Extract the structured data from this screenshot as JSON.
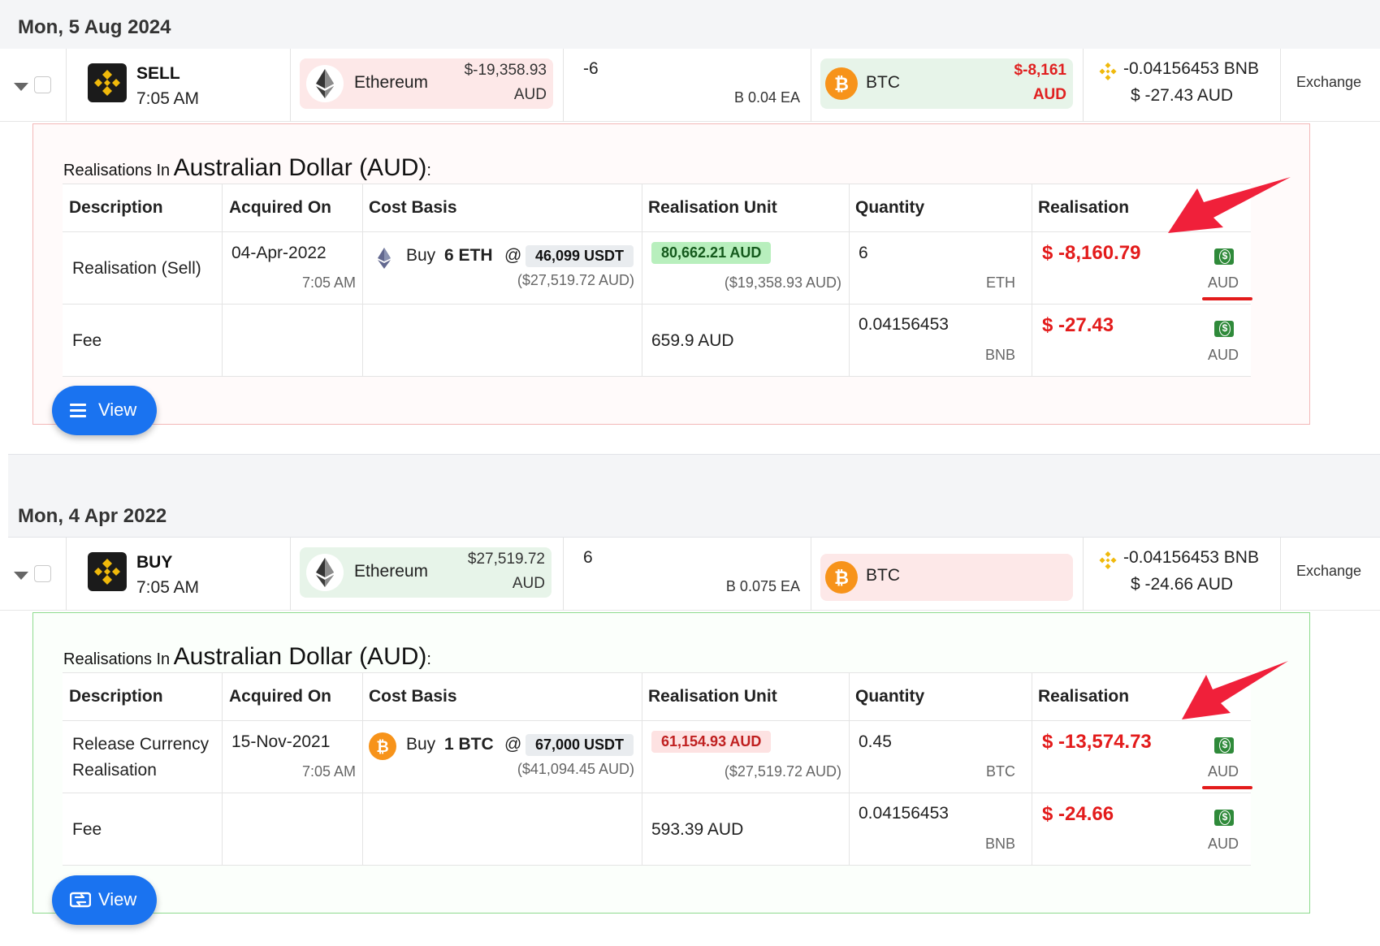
{
  "groups": [
    {
      "date": "Mon, 5 Aug 2024",
      "txn": {
        "side": "SELL",
        "time": "7:05 AM",
        "sent_asset": "Ethereum",
        "sent_value": "$-19,358.93",
        "sent_currency": "AUD",
        "qty": "-6",
        "rate": "B 0.04 EA",
        "recv_asset": "BTC",
        "recv_value": "$-8,161",
        "recv_currency": "AUD",
        "fee_amount": "-0.04156453 BNB",
        "fee_value": "$ -27.43 AUD",
        "type": "Exchange"
      },
      "realisation": {
        "prefix": "Realisations In",
        "currency_name": "Australian Dollar (AUD)",
        "suffix": ":",
        "headers": [
          "Description",
          "Acquired On",
          "Cost Basis",
          "Realisation Unit",
          "Quantity",
          "Realisation"
        ],
        "rows": [
          {
            "description": "Realisation (Sell)",
            "acquired_date": "04-Apr-2022",
            "acquired_time": "7:05 AM",
            "cost_buy": "Buy",
            "cost_qty": "6 ETH",
            "cost_at": "@",
            "cost_price": "46,099 USDT",
            "cost_aud": "($27,519.72 AUD)",
            "unit_value": "80,662.21 AUD",
            "unit_aud": "($19,358.93 AUD)",
            "quantity": "6",
            "quantity_unit": "ETH",
            "realisation": "$ -8,160.79",
            "realisation_currency": "AUD"
          },
          {
            "description": "Fee",
            "unit_value": "659.9 AUD",
            "quantity": "0.04156453",
            "quantity_unit": "BNB",
            "realisation": "$ -27.43",
            "realisation_currency": "AUD"
          }
        ]
      },
      "view_label": "View"
    },
    {
      "date": "Mon, 4 Apr 2022",
      "txn": {
        "side": "BUY",
        "time": "7:05 AM",
        "sent_asset": "Ethereum",
        "sent_value": "$27,519.72",
        "sent_currency": "AUD",
        "qty": "6",
        "rate": "B 0.075 EA",
        "recv_asset": "BTC",
        "fee_amount": "-0.04156453 BNB",
        "fee_value": "$ -24.66 AUD",
        "type": "Exchange"
      },
      "realisation": {
        "prefix": "Realisations In",
        "currency_name": "Australian Dollar (AUD)",
        "suffix": ":",
        "headers": [
          "Description",
          "Acquired On",
          "Cost Basis",
          "Realisation Unit",
          "Quantity",
          "Realisation"
        ],
        "rows": [
          {
            "description_line1": "Release Currency",
            "description_line2": "Realisation",
            "acquired_date": "15-Nov-2021",
            "acquired_time": "7:05 AM",
            "cost_buy": "Buy",
            "cost_qty": "1 BTC",
            "cost_at": "@",
            "cost_price": "67,000 USDT",
            "cost_aud": "($41,094.45 AUD)",
            "unit_value": "61,154.93 AUD",
            "unit_aud": "($27,519.72 AUD)",
            "quantity": "0.45",
            "quantity_unit": "BTC",
            "realisation": "$ -13,574.73",
            "realisation_currency": "AUD"
          },
          {
            "description": "Fee",
            "unit_value": "593.39 AUD",
            "quantity": "0.04156453",
            "quantity_unit": "BNB",
            "realisation": "$ -24.66",
            "realisation_currency": "AUD"
          }
        ]
      },
      "view_label": "View"
    }
  ],
  "colors": {
    "accent_blue": "#1a73f0",
    "loss_red": "#e31b1b",
    "sell_border": "#f3b8b8",
    "buy_border": "#8edb8e",
    "binance_yellow": "#f0b90b",
    "btc_orange": "#f7931a"
  },
  "icons": [
    "binance-logo-icon",
    "ethereum-icon",
    "bitcoin-icon",
    "bnb-icon",
    "money-bill-icon",
    "menu-lines-icon",
    "exchange-icon",
    "chevron-down-icon",
    "red-arrow-annotation"
  ]
}
